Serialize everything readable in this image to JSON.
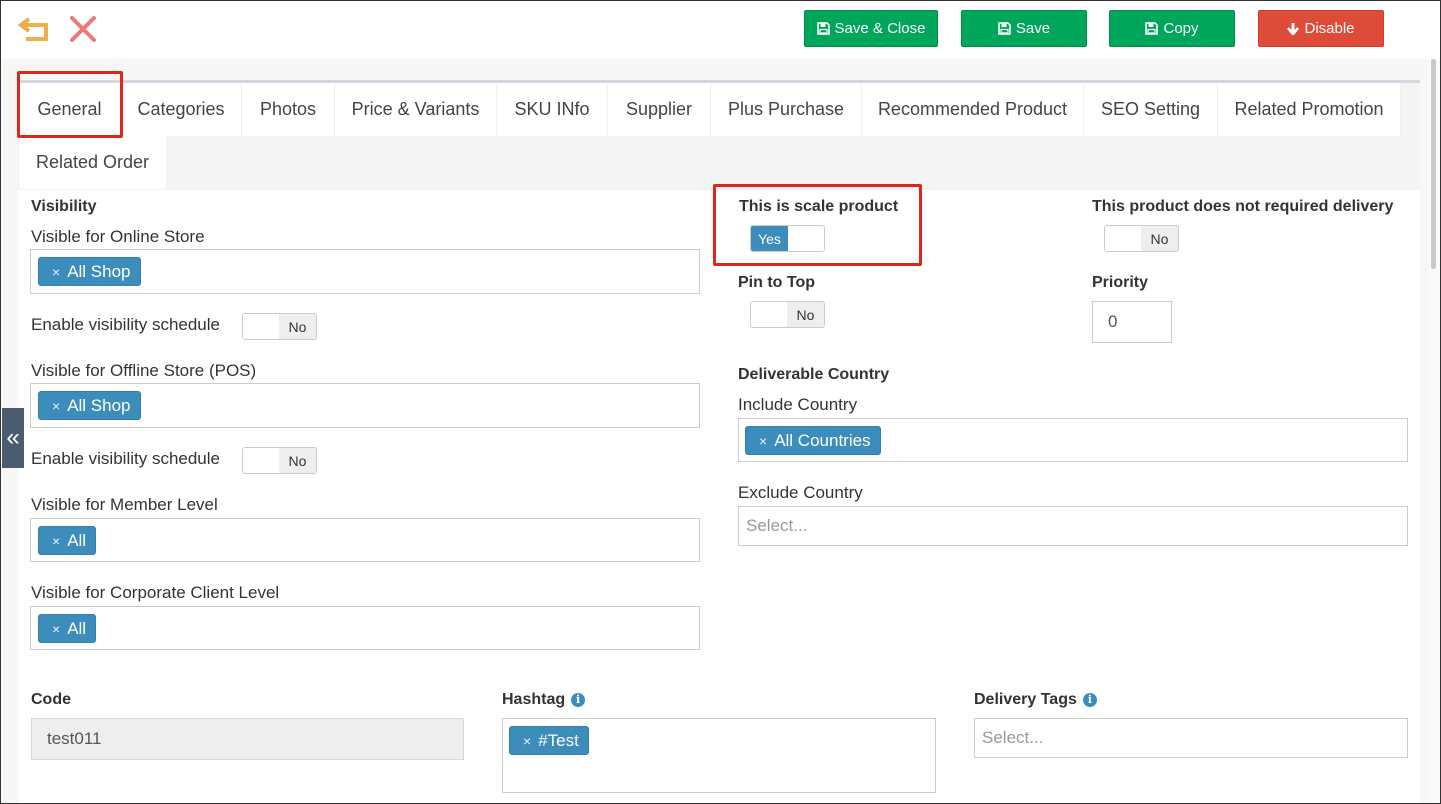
{
  "toolbar": {
    "save_close_label": "Save & Close",
    "save_label": "Save",
    "copy_label": "Copy",
    "disable_label": "Disable"
  },
  "tabs": [
    {
      "label": "General",
      "active": true
    },
    {
      "label": "Categories"
    },
    {
      "label": "Photos"
    },
    {
      "label": "Price & Variants"
    },
    {
      "label": "SKU INfo"
    },
    {
      "label": "Supplier"
    },
    {
      "label": "Plus Purchase"
    },
    {
      "label": "Recommended Product"
    },
    {
      "label": "SEO Setting"
    },
    {
      "label": "Related Promotion"
    },
    {
      "label": "Related Order"
    }
  ],
  "general": {
    "visibility_header": "Visibility",
    "online_store_label": "Visible for Online Store",
    "online_store_values": [
      "All Shop"
    ],
    "online_schedule_label": "Enable visibility schedule",
    "online_schedule_state": "No",
    "offline_store_label": "Visible for Offline Store (POS)",
    "offline_store_values": [
      "All Shop"
    ],
    "offline_schedule_label": "Enable visibility schedule",
    "offline_schedule_state": "No",
    "member_level_label": "Visible for Member Level",
    "member_level_values": [
      "All"
    ],
    "corporate_level_label": "Visible for Corporate Client Level",
    "corporate_level_values": [
      "All"
    ],
    "scale_product_label": "This is scale product",
    "scale_product_state": "Yes",
    "no_delivery_label": "This product does not required delivery",
    "no_delivery_state": "No",
    "pin_to_top_label": "Pin to Top",
    "pin_to_top_state": "No",
    "priority_label": "Priority",
    "priority_value": "0",
    "deliverable_country_header": "Deliverable Country",
    "include_country_label": "Include Country",
    "include_country_values": [
      "All Countries"
    ],
    "exclude_country_label": "Exclude Country",
    "exclude_country_placeholder": "Select...",
    "code_label": "Code",
    "code_value": "test011",
    "hashtag_label": "Hashtag",
    "hashtag_values": [
      "#Test"
    ],
    "delivery_tags_label": "Delivery Tags",
    "delivery_tags_placeholder": "Select..."
  },
  "chip_remove_symbol": "×",
  "sidebar_toggle_symbol": "«",
  "colors": {
    "green": "#00a65a",
    "red": "#dd4b39",
    "blue": "#3c8dbc",
    "highlight": "#e0251b",
    "back_icon": "#f0ad4e",
    "close_icon": "#f07878"
  }
}
